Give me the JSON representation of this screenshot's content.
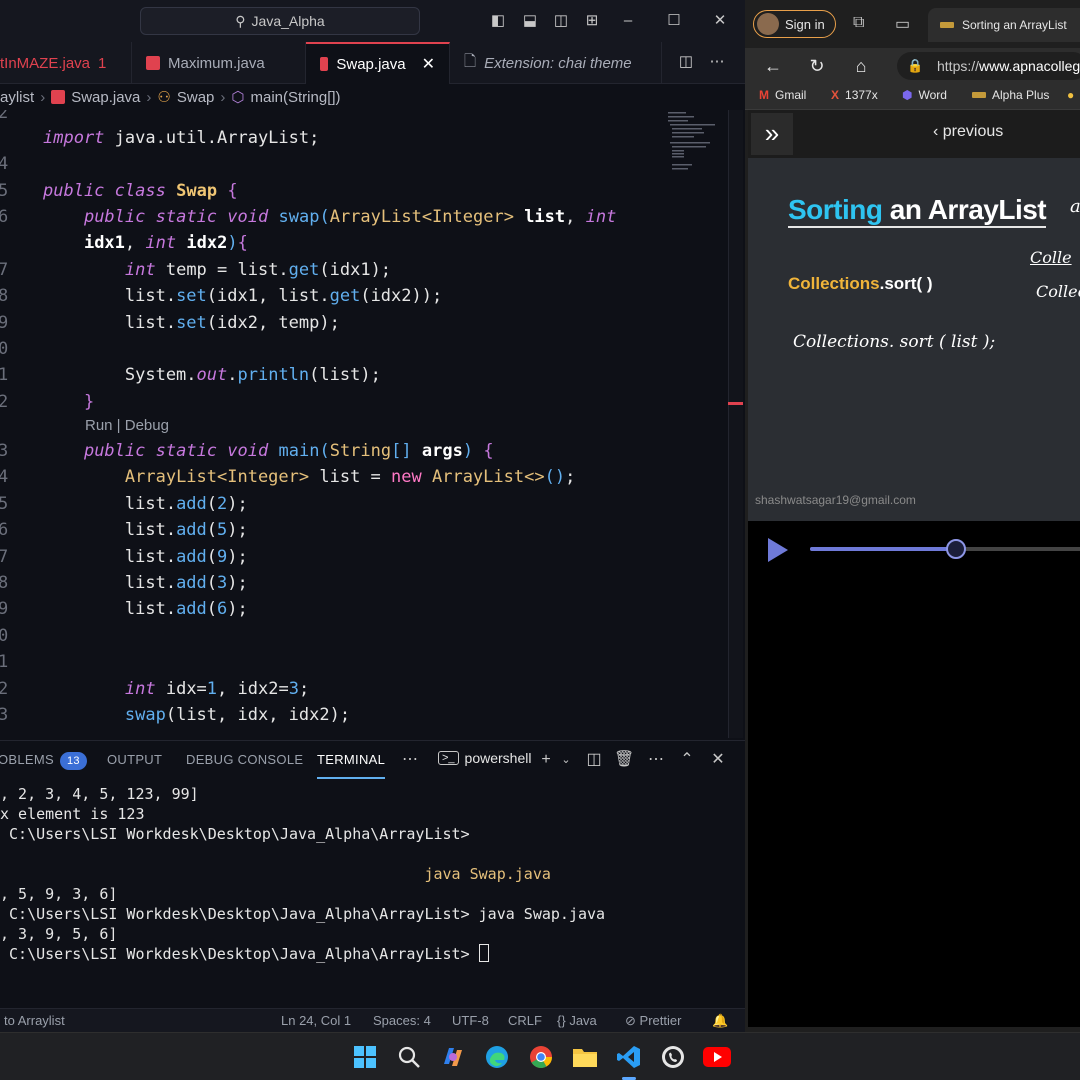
{
  "vscode": {
    "search_text": "Java_Alpha",
    "tabs": [
      {
        "label": "tInMAZE.java",
        "badge": "1"
      },
      {
        "label": "Maximum.java"
      },
      {
        "label": "Swap.java"
      },
      {
        "label": "Extension: chai theme"
      }
    ],
    "breadcrumb": [
      "aylist",
      "Swap.java",
      "Swap",
      "main(String[])"
    ],
    "line_numbers": [
      "2",
      "4",
      "5",
      "6",
      "",
      "7",
      "8",
      "9",
      "0",
      "1",
      "2",
      "",
      "3",
      "4",
      "5",
      "6",
      "7",
      "8",
      "9",
      "0",
      "1",
      "2",
      "3"
    ],
    "codelens": "Run | Debug",
    "panel": {
      "tabs": [
        "OBLEMS",
        "OUTPUT",
        "DEBUG CONSOLE",
        "TERMINAL"
      ],
      "problems_count": "13",
      "shell": "powershell"
    },
    "terminal_lines": [
      ", 2, 3, 4, 5, 123, 99]",
      "x element is 123",
      " C:\\Users\\LSI Workdesk\\Desktop\\Java_Alpha\\ArrayList>",
      "",
      "                                               java Swap.java",
      ", 5, 9, 3, 6]",
      " C:\\Users\\LSI Workdesk\\Desktop\\Java_Alpha\\ArrayList> java Swap.java",
      ", 3, 9, 5, 6]",
      " C:\\Users\\LSI Workdesk\\Desktop\\Java_Alpha\\ArrayList> "
    ],
    "status": {
      "left": "to Arraylist",
      "position": "Ln 24, Col 1",
      "spaces": "Spaces: 4",
      "encoding": "UTF-8",
      "eol": "CRLF",
      "language": "Java",
      "formatter": "Prettier"
    }
  },
  "browser": {
    "sign_in": "Sign in",
    "tab_title": "Sorting an ArrayList",
    "url_prefix": "https://",
    "url_domain": "www.apnacolleg",
    "bookmarks": [
      "Gmail",
      "1377x",
      "Word",
      "Alpha Plus"
    ],
    "previous": "previous",
    "slide": {
      "title_highlight": "Sorting",
      "title_rest": " an ArrayList",
      "subtitle_highlight": "Collections",
      "subtitle_rest": ".sort( )",
      "handwriting": "Collections. sort ( list );",
      "side_note_1": "Colle",
      "side_note_2": "Collec",
      "watermark": "shashwatsagar19@gmail.com"
    },
    "video_progress": 0.52
  },
  "colors": {
    "accent_red": "#e0424f",
    "keyword": "#c678dd",
    "type": "#e5c07b",
    "function": "#61afef",
    "slide_highlight": "#2ec4f1",
    "slide_orange": "#f0b43a",
    "progress": "#6f7ad8"
  }
}
